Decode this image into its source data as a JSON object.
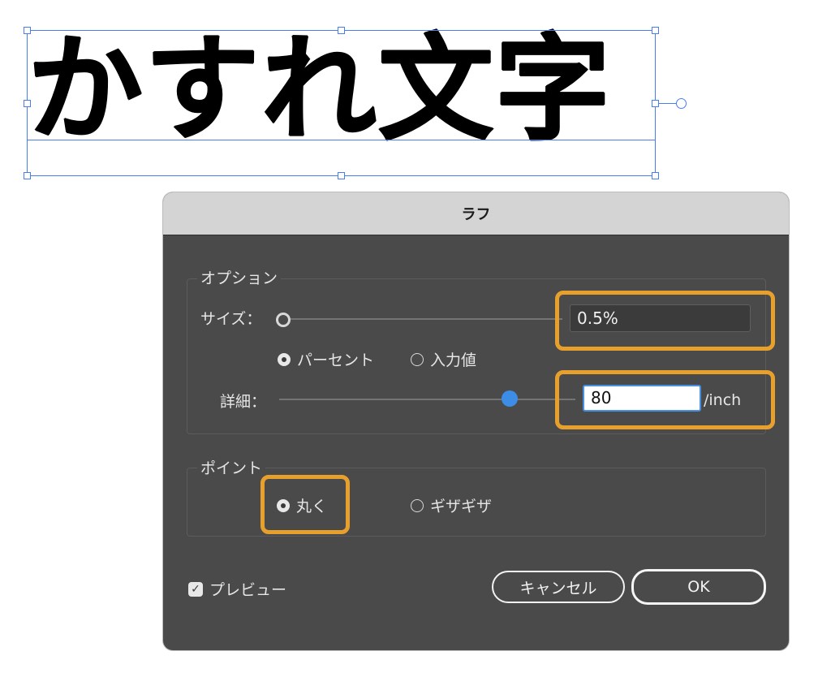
{
  "artwork": {
    "text": "かすれ文字"
  },
  "dialog": {
    "title": "ラフ",
    "options_group": {
      "label": "オプション",
      "size_label": "サイズ：",
      "size_value": "0.5%",
      "unit_options": [
        {
          "label": "パーセント",
          "selected": true
        },
        {
          "label": "入力値",
          "selected": false
        }
      ],
      "detail_label": "詳細：",
      "detail_value": "80",
      "detail_unit": "/inch"
    },
    "points_group": {
      "label": "ポイント",
      "options": [
        {
          "label": "丸く",
          "selected": true
        },
        {
          "label": "ギザギザ",
          "selected": false
        }
      ]
    },
    "preview_label": "プレビュー",
    "preview_checked": true,
    "cancel_label": "キャンセル",
    "ok_label": "OK"
  },
  "colors": {
    "highlight": "#e8a02c",
    "selection": "#4a7df0",
    "slider_accent": "#3d8ce6"
  }
}
